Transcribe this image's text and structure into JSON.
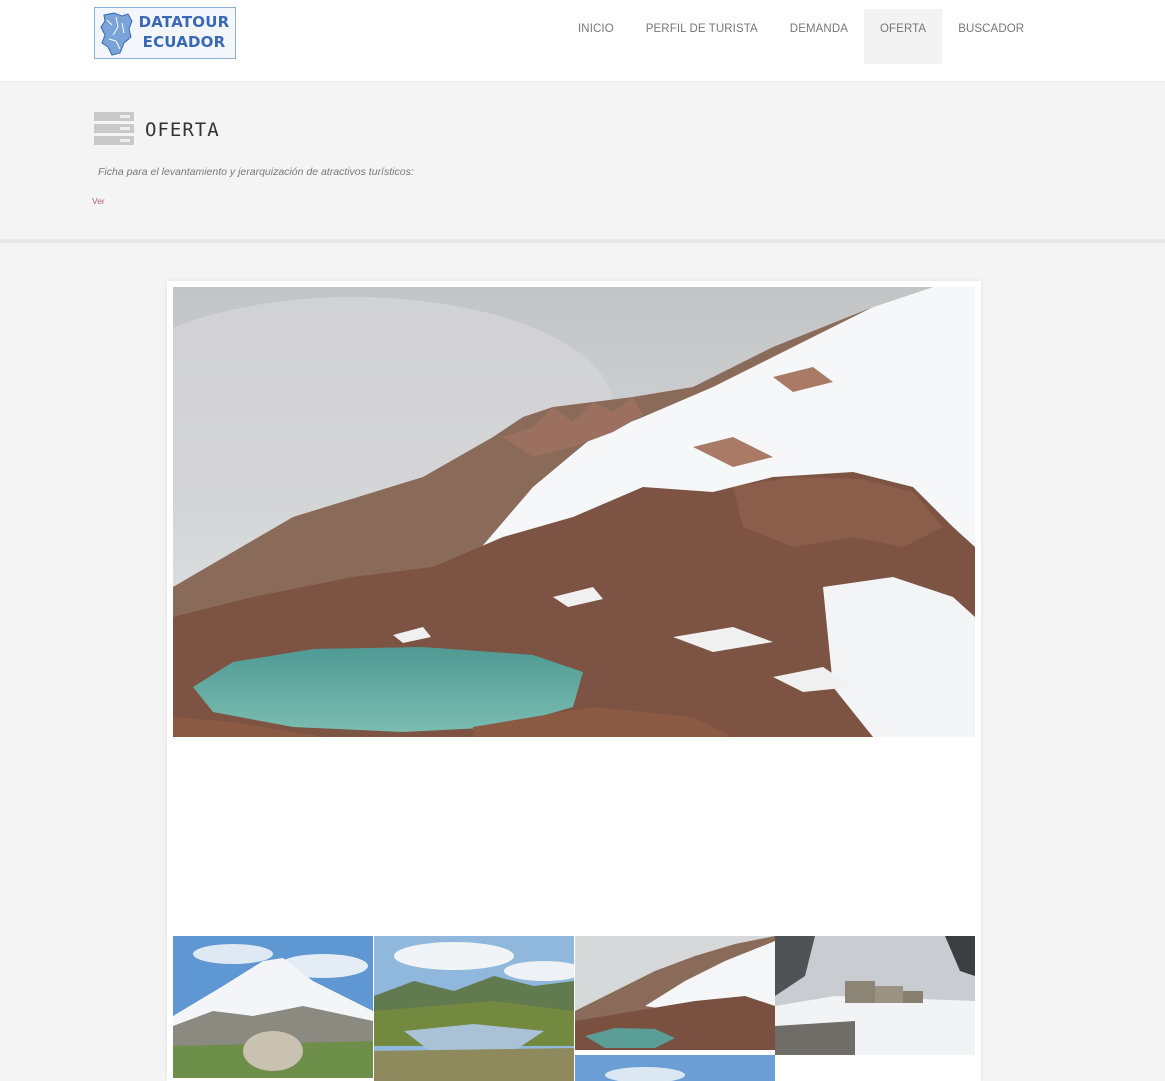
{
  "header": {
    "logo": {
      "line1": "DATATOUR",
      "line2": "ECUADOR"
    },
    "nav": [
      {
        "label": "INICIO",
        "active": false
      },
      {
        "label": "PERFIL DE TURISTA",
        "active": false
      },
      {
        "label": "DEMANDA",
        "active": false
      },
      {
        "label": "OFERTA",
        "active": true
      },
      {
        "label": "BUSCADOR",
        "active": false
      }
    ]
  },
  "page": {
    "title": "OFERTA",
    "subtitle": "Ficha para el levantamiento y jerarquización de atractivos turísticos:",
    "link": "Ver",
    "icon": "stack-icon"
  },
  "gallery": {
    "main_image": "snowy-mountain-lagoon",
    "thumbnails": [
      "snow-capped-volcano",
      "valley-lake",
      "snowy-mountain-lagoon",
      "mountain-refuge-in-snow",
      "blue-sky"
    ]
  },
  "colors": {
    "logo_blue": "#3868b6",
    "link": "#b05a78",
    "active_nav_bg": "#f3f3f3"
  }
}
